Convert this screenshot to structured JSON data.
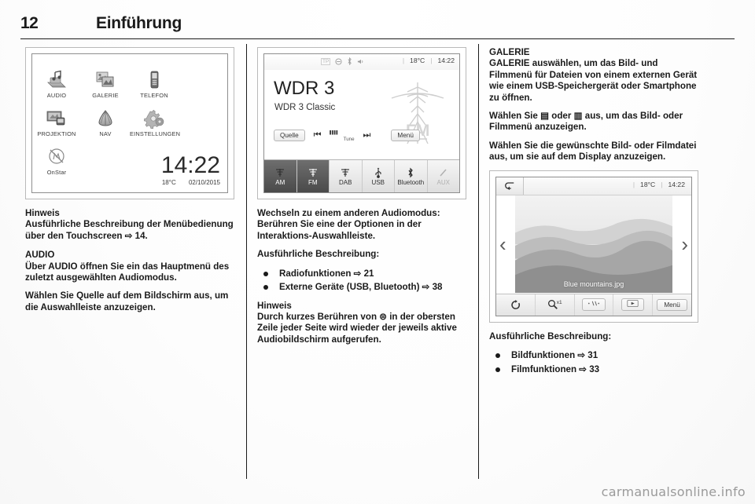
{
  "header": {
    "page_number": "12",
    "title": "Einführung"
  },
  "watermark": "carmanualsonline.info",
  "column1": {
    "home_screen": {
      "tiles": [
        {
          "label": "AUDIO",
          "icon": "audio-icon"
        },
        {
          "label": "GALERIE",
          "icon": "gallery-icon"
        },
        {
          "label": "TELEFON",
          "icon": "phone-icon"
        },
        {
          "label": "PROJEKTION",
          "icon": "projection-icon"
        },
        {
          "label": "NAV",
          "icon": "navigation-icon"
        },
        {
          "label": "EINSTELLUNGEN",
          "icon": "settings-gears-icon"
        },
        {
          "label": "OnStar",
          "icon": "onstar-icon"
        }
      ],
      "clock": "14:22",
      "temperature": "18°C",
      "date": "02/10/2015"
    },
    "note_heading": "Hinweis",
    "note_text": "Ausführliche Beschreibung der Menübedienung über den Touchscreen ⇨ 14.",
    "audio_heading": "AUDIO",
    "audio_p1": "Über AUDIO öffnen Sie ein das Hauptmenü des zuletzt ausgewählten Audiomodus.",
    "audio_p2": "Wählen Sie Quelle auf dem Bildschirm aus, um die Auswahlleiste anzuzeigen."
  },
  "column2": {
    "radio_screen": {
      "status_icons": [
        "tp-indicator",
        "no-entry-icon",
        "bluetooth-icon",
        "speaker-icon"
      ],
      "tp_label": "TP",
      "temperature": "18°C",
      "clock": "14:22",
      "station_name": "WDR 3",
      "station_info": "WDR 3 Classic",
      "source_button": "Quelle",
      "prev_button": "⏮",
      "tune_label": "Tune",
      "next_button": "⏭",
      "menu_button": "Menü",
      "band_logo": "FM",
      "tabs": [
        {
          "label": "AM",
          "icon": "antenna-icon",
          "state": "normal"
        },
        {
          "label": "FM",
          "icon": "antenna-icon",
          "state": "active"
        },
        {
          "label": "DAB",
          "icon": "antenna-icon",
          "state": "normal"
        },
        {
          "label": "USB",
          "icon": "usb-icon",
          "state": "normal"
        },
        {
          "label": "Bluetooth",
          "icon": "bluetooth-icon",
          "state": "normal"
        },
        {
          "label": "AUX",
          "icon": "aux-jack-icon",
          "state": "disabled"
        }
      ]
    },
    "p1": "Wechseln zu einem anderen Audiomodus: Berühren Sie eine der Optionen in der Interaktions-Auswahlleiste.",
    "p2": "Ausführliche Beschreibung:",
    "bullets": [
      "Radiofunktionen ⇨ 21",
      "Externe Geräte (USB, Bluetooth) ⇨ 38"
    ],
    "note_heading": "Hinweis",
    "note_text": "Durch kurzes Berühren von ⊜ in der obersten Zeile jeder Seite wird wieder der jeweils aktive Audiobildschirm aufgerufen."
  },
  "column3": {
    "gallery_heading": "GALERIE",
    "p1": "GALERIE auswählen, um das Bild- und Filmmenü für Dateien von einem externen Gerät wie einem USB-Speichergerät oder Smartphone zu öffnen.",
    "p2": "Wählen Sie ▤ oder ▥ aus, um das Bild- oder Filmmenü anzuzeigen.",
    "p3": "Wählen Sie die gewünschte Bild- oder Filmdatei aus, um sie auf dem Display anzuzeigen.",
    "gallery_screen": {
      "back_icon": "back-arrow-icon",
      "temperature": "18°C",
      "clock": "14:22",
      "image_caption": "Blue mountains.jpg",
      "prev_chevron": "‹",
      "next_chevron": "›",
      "toolbar": [
        {
          "icon": "rotate-icon",
          "label": "↻"
        },
        {
          "icon": "zoom-icon",
          "label": "x1"
        },
        {
          "icon": "brightness-icon",
          "label": ""
        },
        {
          "icon": "slideshow-play-icon",
          "label": "▶"
        },
        {
          "icon": "menu-button",
          "label": "Menü"
        }
      ]
    },
    "p4": "Ausführliche Beschreibung:",
    "bullets": [
      "Bildfunktionen ⇨ 31",
      "Filmfunktionen ⇨ 33"
    ]
  },
  "colors": {
    "text": "#1a1a1a",
    "rule": "#1a1a1a",
    "active_tab_bg": "#4a4a4a",
    "disabled_text": "#b0b0b0",
    "watermark": "#9a9a9a"
  }
}
